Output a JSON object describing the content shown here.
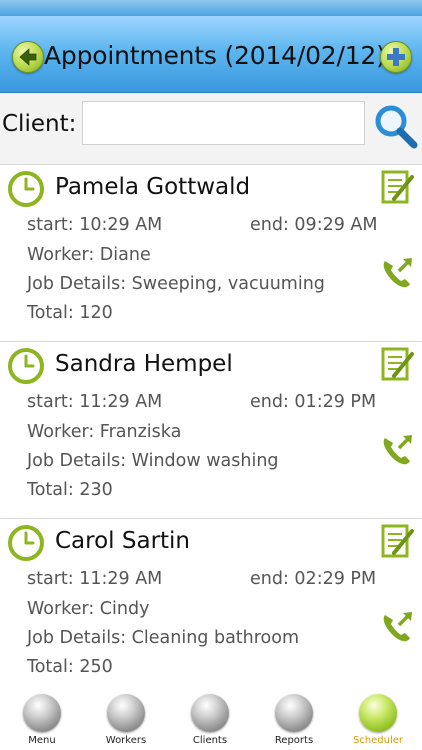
{
  "header": {
    "title": "Appointments (2014/02/12)",
    "back_icon": "left-arrow-icon",
    "add_icon": "plus-icon"
  },
  "search": {
    "label": "Client:",
    "value": "",
    "placeholder": ""
  },
  "appointments": [
    {
      "client": "Pamela Gottwald",
      "start": "start: 10:29 AM",
      "end": "end: 09:29 AM",
      "worker": "Worker: Diane",
      "job": "Job Details: Sweeping, vacuuming",
      "total": "Total: 120"
    },
    {
      "client": "Sandra Hempel",
      "start": "start: 11:29 AM",
      "end": "end: 01:29 PM",
      "worker": "Worker: Franziska",
      "job": "Job Details: Window washing",
      "total": "Total: 230"
    },
    {
      "client": "Carol Sartin",
      "start": "start: 11:29 AM",
      "end": "end: 02:29 PM",
      "worker": "Worker: Cindy",
      "job": "Job Details: Cleaning bathroom",
      "total": "Total: 250"
    }
  ],
  "nav": {
    "items": [
      {
        "label": "Menu"
      },
      {
        "label": "Workers"
      },
      {
        "label": "Clients"
      },
      {
        "label": "Reports"
      },
      {
        "label": "Scheduler"
      }
    ],
    "active_index": 4
  },
  "colors": {
    "header_blue": "#5db6ef",
    "accent_green": "#8fbf1e",
    "active_label": "#d99a00"
  }
}
